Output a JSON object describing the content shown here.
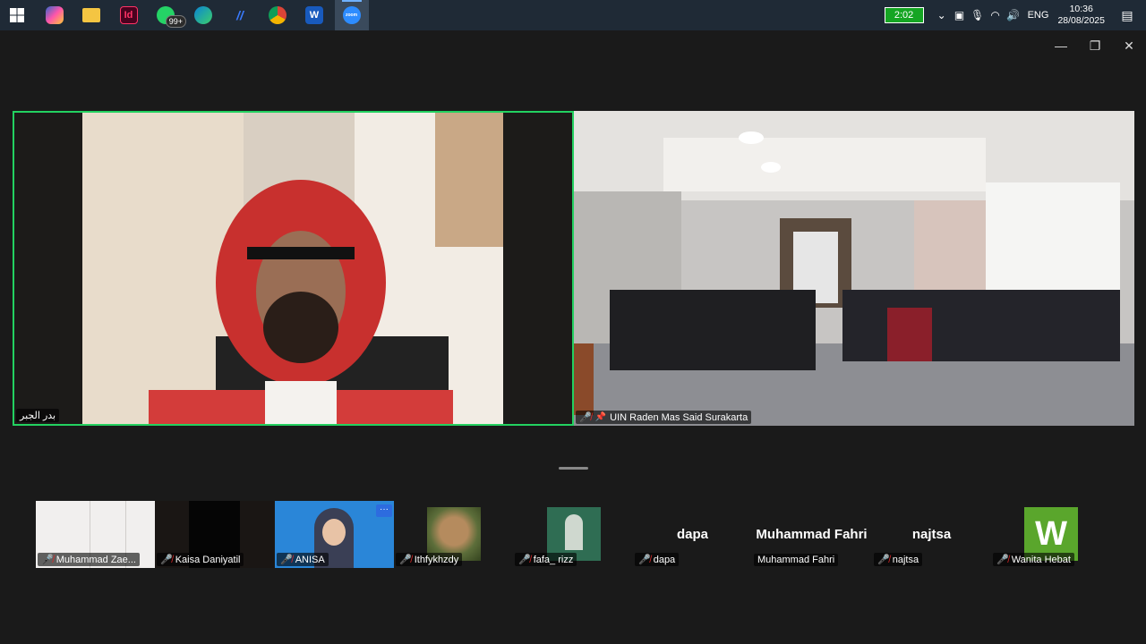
{
  "taskbar": {
    "apps": [
      {
        "name": "windows-start",
        "label": ""
      },
      {
        "name": "copilot",
        "label": ""
      },
      {
        "name": "file-explorer",
        "label": ""
      },
      {
        "name": "indesign",
        "label": "Id"
      },
      {
        "name": "whatsapp",
        "label": "",
        "badge": "99+"
      },
      {
        "name": "edge",
        "label": ""
      },
      {
        "name": "editor",
        "label": "//"
      },
      {
        "name": "chrome",
        "label": ""
      },
      {
        "name": "word",
        "label": "W"
      },
      {
        "name": "zoom",
        "label": "zoom"
      }
    ],
    "battery": "2:02",
    "language": "ENG",
    "time": "10:36",
    "date": "28/08/2025"
  },
  "main_videos": [
    {
      "participant": "بدر الجبر",
      "muted": false
    },
    {
      "participant": "UIN Raden Mas Said Surakarta",
      "muted": true,
      "pinned": true
    }
  ],
  "gallery": [
    {
      "name": "Muhammad Zae...",
      "muted": true,
      "type": "video"
    },
    {
      "name": "Kaisa Daniyatil",
      "muted": true,
      "type": "video"
    },
    {
      "name": "ANISA",
      "muted": true,
      "type": "video"
    },
    {
      "name": "Ithfykhzdy",
      "muted": true,
      "type": "image"
    },
    {
      "name": "fafa_ rizz",
      "muted": true,
      "type": "image"
    },
    {
      "name": "dapa",
      "muted": true,
      "type": "name",
      "display": "dapa"
    },
    {
      "name": "Muhammad Fahri",
      "muted": false,
      "type": "name",
      "display": "Muhammad Fahri"
    },
    {
      "name": "najtsa",
      "muted": true,
      "type": "name",
      "display": "najtsa"
    },
    {
      "name": "Wanita Hebat",
      "muted": true,
      "type": "letter",
      "display": "W"
    }
  ],
  "colors": {
    "active_speaker": "#23d160",
    "muted_mic": "#e02828",
    "letter_avatar": "#5aa62c"
  }
}
